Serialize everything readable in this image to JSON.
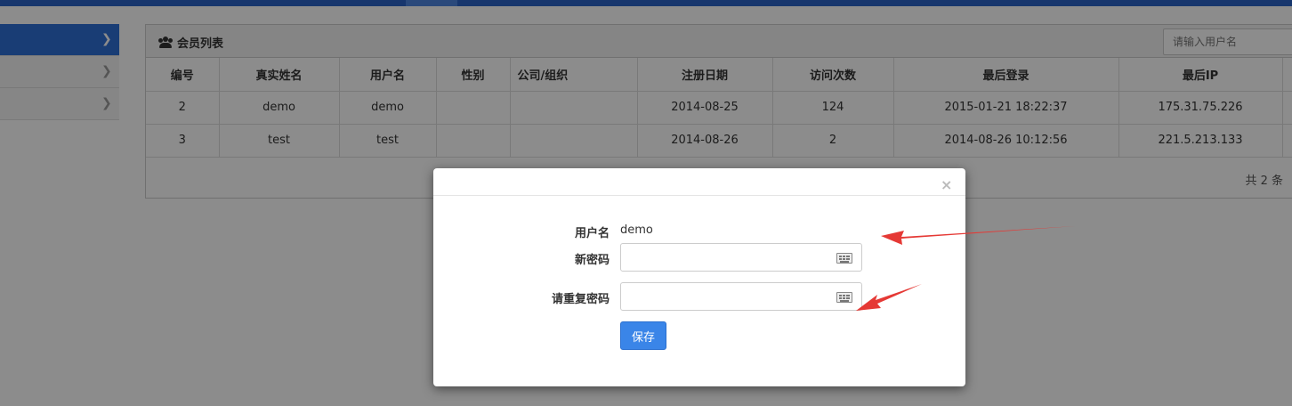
{
  "panel": {
    "title": "会员列表",
    "search_placeholder": "请输入用户名"
  },
  "table": {
    "headers": [
      "编号",
      "真实姓名",
      "用户名",
      "性别",
      "公司/组织",
      "注册日期",
      "访问次数",
      "最后登录",
      "最后IP"
    ],
    "rows": [
      [
        "2",
        "demo",
        "demo",
        "",
        "",
        "2014-08-25",
        "124",
        "2015-01-21 18:22:37",
        "175.31.75.226"
      ],
      [
        "3",
        "test",
        "test",
        "",
        "",
        "2014-08-26",
        "2",
        "2014-08-26 10:12:56",
        "221.5.213.133"
      ]
    ],
    "pager_text": "共 2 条"
  },
  "modal": {
    "close_symbol": "×",
    "username_label": "用户名",
    "username_value": "demo",
    "new_password_label": "新密码",
    "repeat_password_label": "请重复密码",
    "save_label": "保存"
  },
  "colors": {
    "topbar": "#2a63c7",
    "sidebar_active": "#2f6fd6",
    "save_button": "#3a85e8",
    "annotation_arrow": "#e53935"
  }
}
